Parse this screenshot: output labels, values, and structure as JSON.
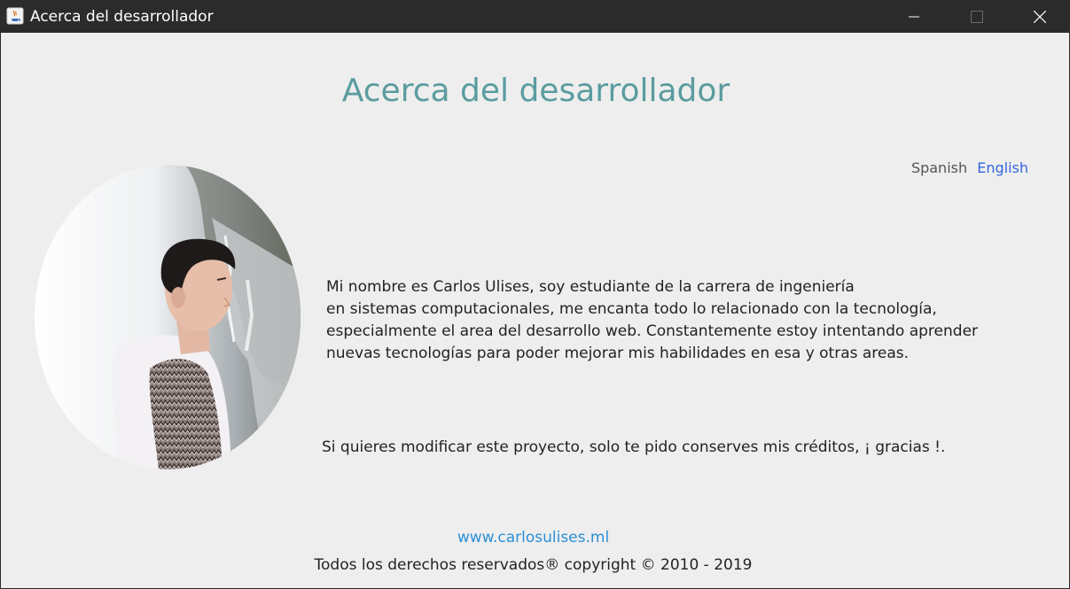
{
  "window": {
    "title": "Acerca del desarrollador",
    "controls": {
      "minimize": "minimize-icon",
      "maximize": "maximize-icon",
      "close": "close-icon"
    }
  },
  "heading": "Acerca del desarrollador",
  "language": {
    "spanish": "Spanish",
    "english": "English"
  },
  "bio": {
    "lines": [
      "Mi nombre es Carlos Ulises, soy estudiante de la carrera de ingeniería",
      "en sistemas computacionales, me encanta todo lo relacionado con la tecnología,",
      "especialmente el area del desarrollo web. Constantemente estoy intentando aprender",
      "nuevas tecnologías para poder mejorar mis habilidades en esa y otras areas."
    ]
  },
  "note": "Si quieres modificar este proyecto, solo te pido conserves mis créditos, ¡ gracias !.",
  "footer": {
    "website": "www.carlosulises.ml",
    "copyright": "Todos los derechos reservados® copyright © 2010 - 2019"
  },
  "colors": {
    "heading": "#5b9c9f",
    "link": "#2b8fd6",
    "english_link": "#3366dd",
    "titlebar": "#2b2b2b"
  }
}
